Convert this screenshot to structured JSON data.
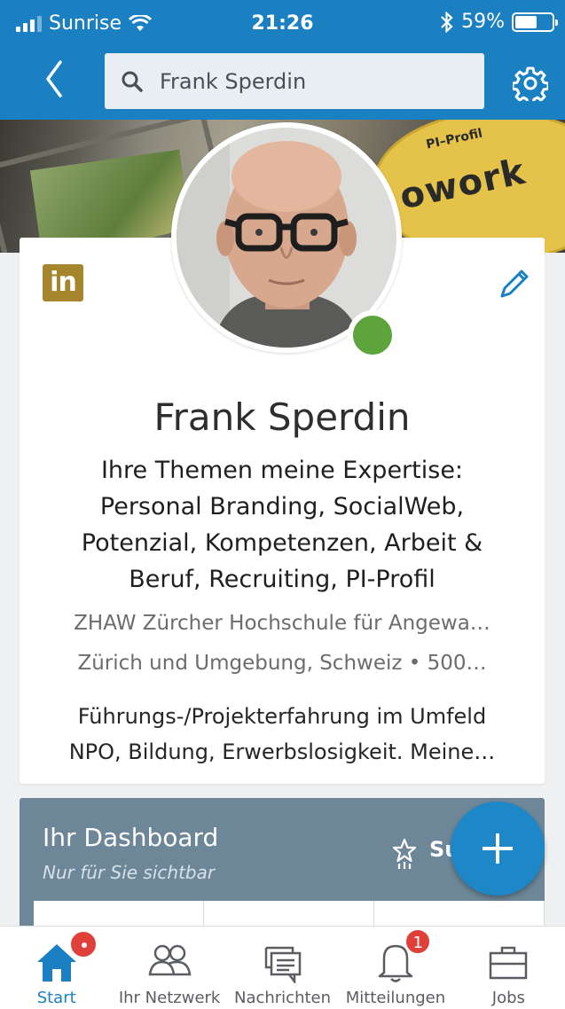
{
  "status_bar": {
    "carrier": "Sunrise",
    "time": "21:26",
    "battery": "59%",
    "battery_level": 0.59
  },
  "header": {
    "search_value": "Frank Sperdin"
  },
  "profile": {
    "name": "Frank Sperdin",
    "headline": [
      "Ihre Themen meine Expertise:",
      "Personal Branding, SocialWeb,",
      "Potenzial, Kompetenzen, Arbeit &",
      "Beruf, Recruiting, PI-Profil"
    ],
    "education": "ZHAW Zürcher Hochschule für Angewa…",
    "location": "Zürich und Umgebung, Schweiz • 500…",
    "summary": [
      "Führungs-/Projekterfahrung im Umfeld",
      "NPO, Bildung, Erwerbslosigkeit. Meine…"
    ],
    "logo_text": "in",
    "online": true
  },
  "cover": {
    "disc_title": "PI–Profil",
    "disc_text": "owork"
  },
  "dashboard": {
    "title": "Ihr Dashboard",
    "subtitle": "Nur für Sie sichtbar",
    "action_partial": "Su"
  },
  "nav": {
    "items": [
      {
        "label": "Start",
        "icon": "home-icon",
        "active": true
      },
      {
        "label": "Ihr Netzwerk",
        "icon": "network-icon",
        "active": false
      },
      {
        "label": "Nachrichten",
        "icon": "messages-icon",
        "active": false
      },
      {
        "label": "Mitteilungen",
        "icon": "bell-icon",
        "active": false,
        "badge": "1"
      },
      {
        "label": "Jobs",
        "icon": "briefcase-icon",
        "active": false
      }
    ]
  },
  "colors": {
    "brand_blue": "#1a80c2",
    "online_green": "#5da43a",
    "badge_red": "#e0403a",
    "dashboard_slate": "#6d8799",
    "linkedin_gold": "#a5862d"
  }
}
